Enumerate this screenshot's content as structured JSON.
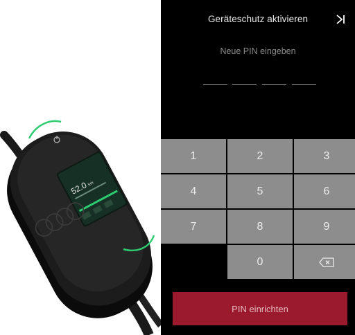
{
  "header": {
    "title": "Geräteschutz aktivieren",
    "skip_icon": "skip-next-icon"
  },
  "pin_entry": {
    "prompt": "Neue PIN eingeben",
    "digit_count": 4
  },
  "keypad": {
    "keys": [
      "1",
      "2",
      "3",
      "4",
      "5",
      "6",
      "7",
      "8",
      "9",
      "0"
    ],
    "backspace_icon": "backspace-icon"
  },
  "submit": {
    "label": "PIN einrichten"
  },
  "device_display": {
    "value": "52.0",
    "unit": "km"
  },
  "colors": {
    "screen_bg": "#000000",
    "key_bg": "#8d8d8d",
    "submit_bg": "#9b1a2e",
    "device_accent": "#2ecc71"
  }
}
